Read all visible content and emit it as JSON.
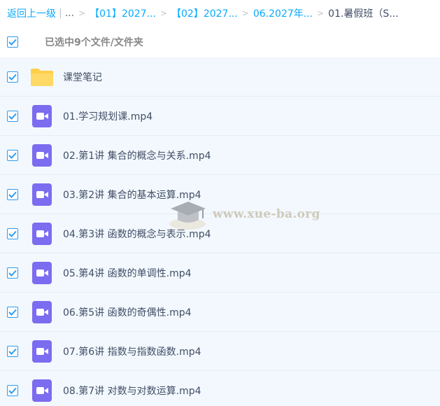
{
  "breadcrumb": {
    "back_label": "返回上一级",
    "pipe": "|",
    "ellipsis": "...",
    "sep": ">",
    "items": [
      "【01】2027...",
      "【02】2027...",
      "06.2027年..."
    ],
    "current": "01.暑假班（S..."
  },
  "selection": {
    "summary": "已选中9个文件/文件夹",
    "checked": true
  },
  "files": [
    {
      "name": "课堂笔记",
      "type": "folder",
      "checked": true
    },
    {
      "name": "01.学习规划课.mp4",
      "type": "video",
      "checked": true
    },
    {
      "name": "02.第1讲 集合的概念与关系.mp4",
      "type": "video",
      "checked": true
    },
    {
      "name": "03.第2讲 集合的基本运算.mp4",
      "type": "video",
      "checked": true
    },
    {
      "name": "04.第3讲 函数的概念与表示.mp4",
      "type": "video",
      "checked": true
    },
    {
      "name": "05.第4讲 函数的单调性.mp4",
      "type": "video",
      "checked": true
    },
    {
      "name": "06.第5讲 函数的奇偶性.mp4",
      "type": "video",
      "checked": true
    },
    {
      "name": "07.第6讲 指数与指数函数.mp4",
      "type": "video",
      "checked": true
    },
    {
      "name": "08.第7讲 对数与对数运算.mp4",
      "type": "video",
      "checked": true
    }
  ],
  "watermark": {
    "text": "www.xue-ba.org"
  },
  "colors": {
    "accent": "#09aaff",
    "checkbox": "#2d9cf0",
    "folder": "#ffcf4a",
    "video": "#7b6cf0",
    "row_bg": "#f2f8fd"
  }
}
